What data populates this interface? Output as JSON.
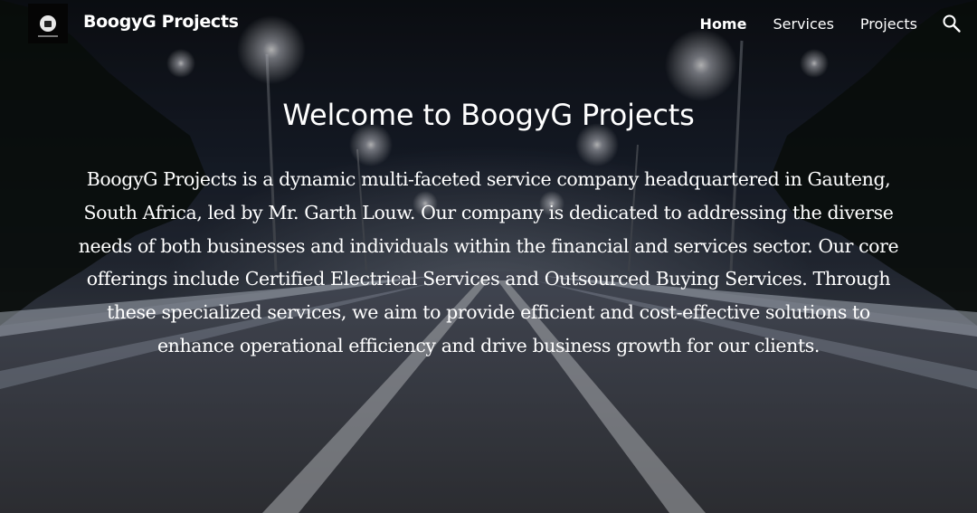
{
  "header": {
    "site_title": "BoogyG Projects",
    "nav": [
      {
        "label": "Home",
        "active": true
      },
      {
        "label": "Services",
        "active": false
      },
      {
        "label": "Projects",
        "active": false
      }
    ],
    "search_icon": "search-icon"
  },
  "hero": {
    "title": "Welcome to BoogyG Projects",
    "body": "BoogyG Projects is a dynamic multi-faceted service company headquartered in Gauteng, South Africa, led by Mr. Garth Louw. Our company is dedicated to addressing the diverse needs of both businesses and individuals within the financial and services sector. Our core offerings include Certified Electrical Services and Outsourced Buying Services. Through these specialized services, we aim to provide efficient and cost-effective solutions to enhance operational efficiency and drive business growth for our clients."
  },
  "colors": {
    "text": "#ffffff",
    "logo_bg": "#050505"
  }
}
